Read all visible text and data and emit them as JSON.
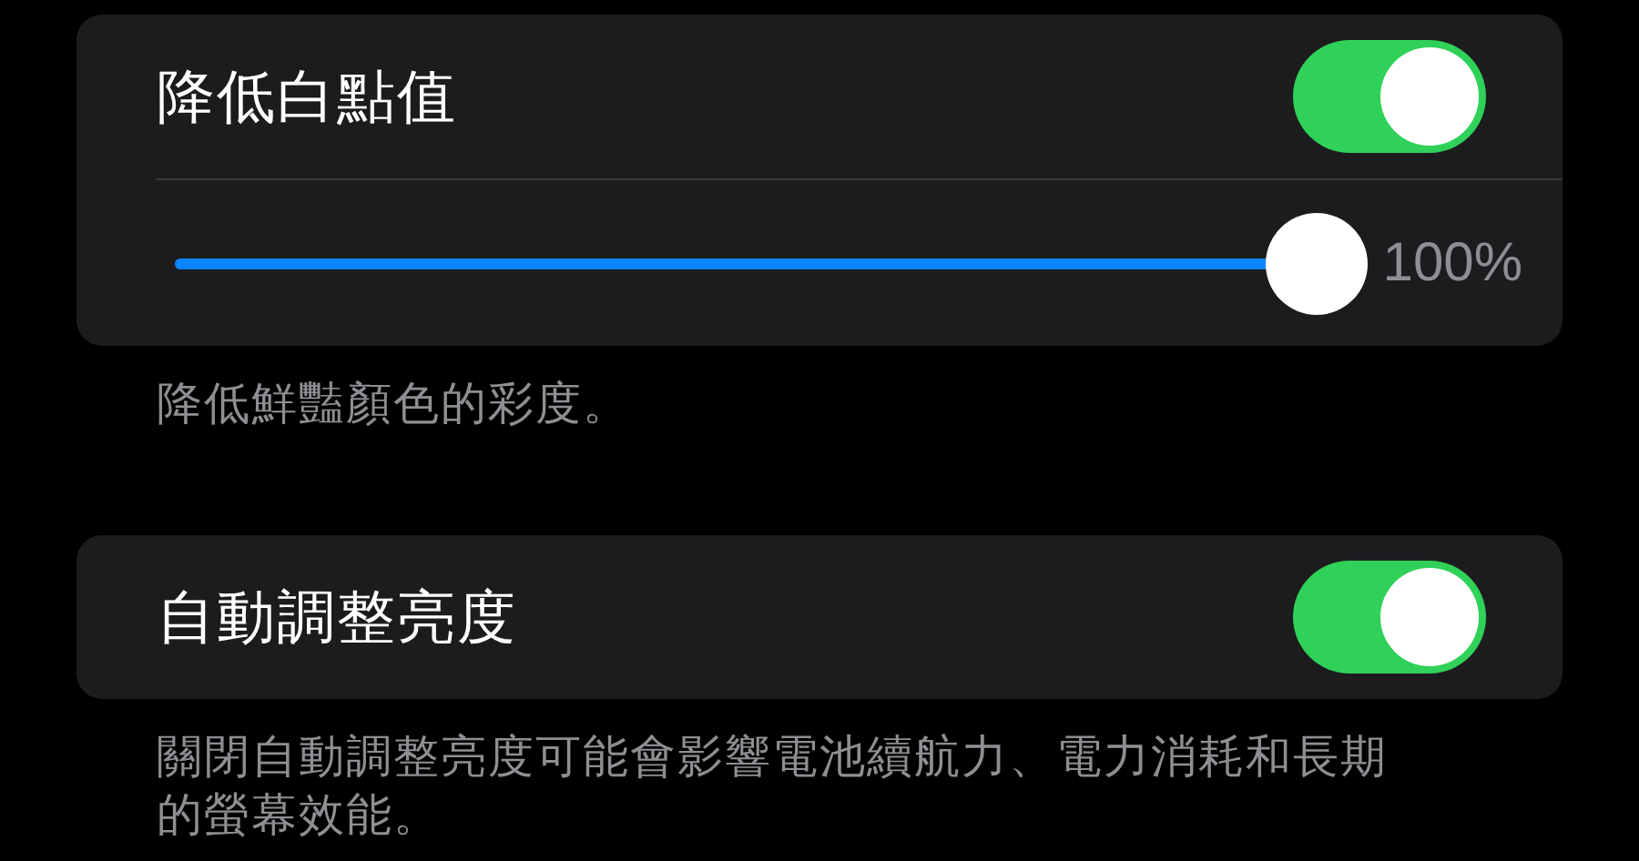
{
  "sections": [
    {
      "title": "降低白點值",
      "on": true,
      "slider": {
        "level": 1.0,
        "reading": "100%"
      },
      "footer": "降低鮮豔顏色的彩度。"
    },
    {
      "title": "自動調整亮度",
      "on": true,
      "footer": "關閉自動調整亮度可能會影響電池續航力、電力消耗和長期的螢幕效能。"
    }
  ]
}
